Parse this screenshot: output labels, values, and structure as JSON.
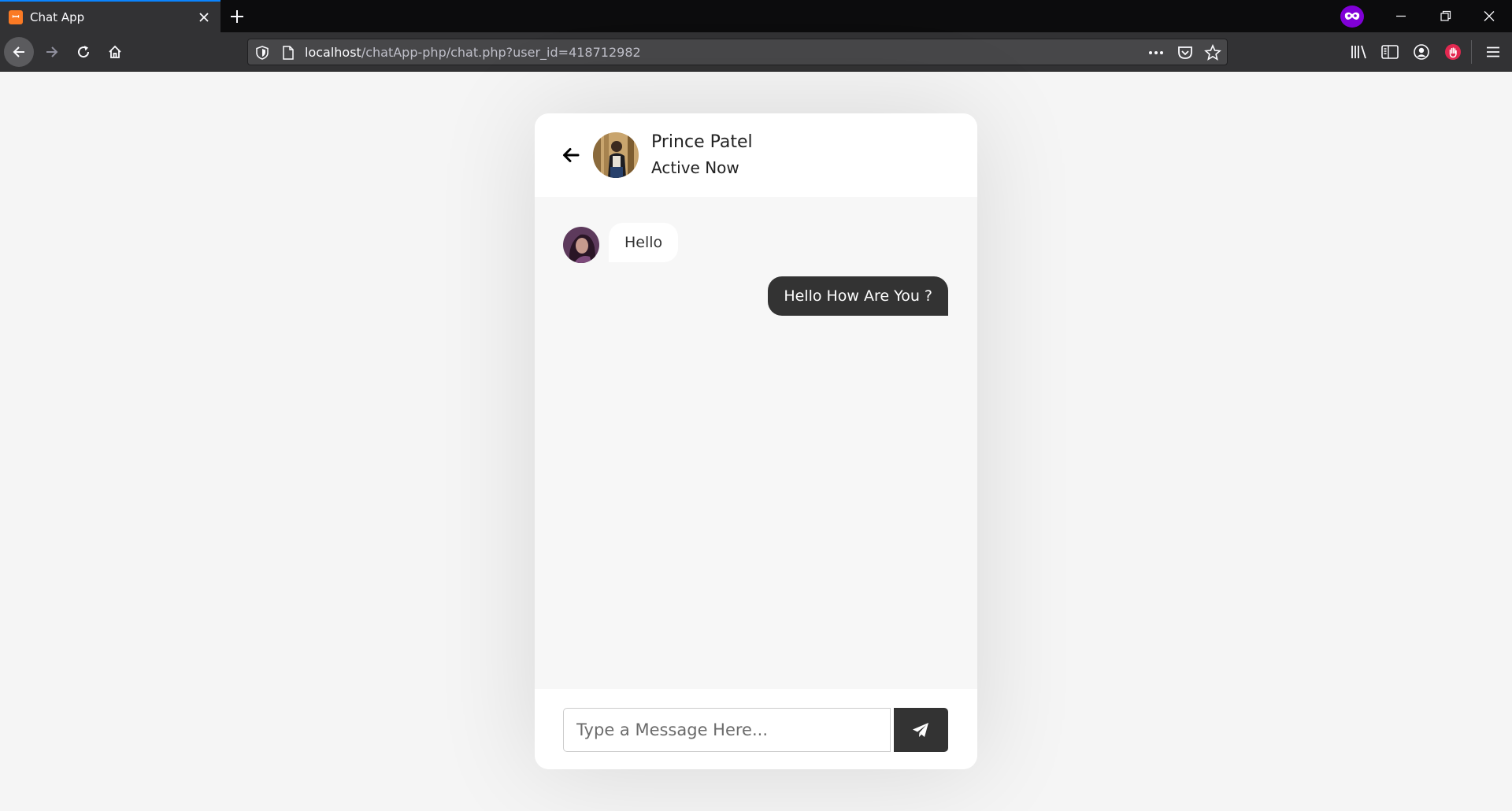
{
  "browser": {
    "tab": {
      "title": "Chat App",
      "favicon_icon": "xampp-icon"
    },
    "url": {
      "host": "localhost",
      "path": "/chatApp-php/chat.php?user_id=418712982"
    },
    "accent_color": "#0a84ff",
    "private_badge_color": "#8000d7"
  },
  "chat": {
    "header": {
      "name": "Prince Patel",
      "status": "Active Now"
    },
    "messages": [
      {
        "direction": "incoming",
        "text": "Hello"
      },
      {
        "direction": "outgoing",
        "text": "Hello How Are You ?"
      }
    ],
    "input": {
      "placeholder": "Type a Message Here...",
      "value": ""
    },
    "send_icon": "paper-plane-icon",
    "colors": {
      "outgoing_bubble": "#333333",
      "incoming_bubble": "#ffffff",
      "background": "#f5f5f5"
    }
  }
}
